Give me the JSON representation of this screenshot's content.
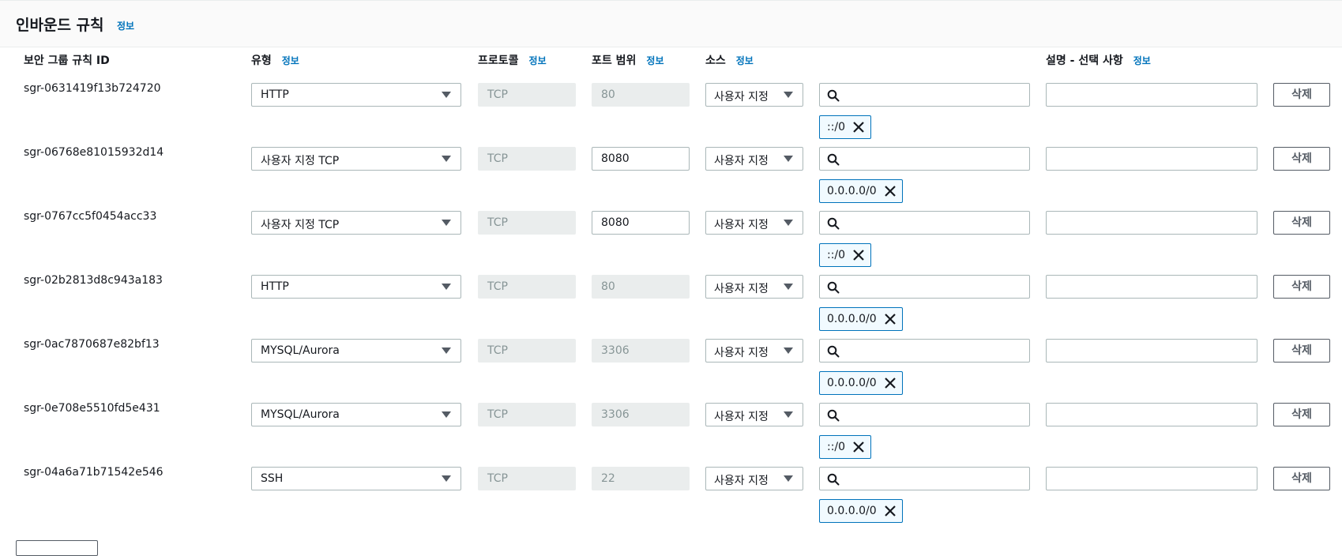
{
  "panel": {
    "title": "인바운드 규칙",
    "info": "정보"
  },
  "columns": {
    "rule_id": "보안 그룹 규칙 ID",
    "type": "유형",
    "protocol": "프로토콜",
    "port_range": "포트 범위",
    "source": "소스",
    "description": "설명 - 선택 사항",
    "info": "정보"
  },
  "rules": [
    {
      "id": "sgr-0631419f13b724720",
      "type": "HTTP",
      "protocol": "TCP",
      "port": "80",
      "port_editable": false,
      "source": "사용자 지정",
      "cidr": "::/0",
      "description": "",
      "delete_label": "삭제"
    },
    {
      "id": "sgr-06768e81015932d14",
      "type": "사용자 지정 TCP",
      "protocol": "TCP",
      "port": "8080",
      "port_editable": true,
      "source": "사용자 지정",
      "cidr": "0.0.0.0/0",
      "description": "",
      "delete_label": "삭제"
    },
    {
      "id": "sgr-0767cc5f0454acc33",
      "type": "사용자 지정 TCP",
      "protocol": "TCP",
      "port": "8080",
      "port_editable": true,
      "source": "사용자 지정",
      "cidr": "::/0",
      "description": "",
      "delete_label": "삭제"
    },
    {
      "id": "sgr-02b2813d8c943a183",
      "type": "HTTP",
      "protocol": "TCP",
      "port": "80",
      "port_editable": false,
      "source": "사용자 지정",
      "cidr": "0.0.0.0/0",
      "description": "",
      "delete_label": "삭제"
    },
    {
      "id": "sgr-0ac7870687e82bf13",
      "type": "MYSQL/Aurora",
      "protocol": "TCP",
      "port": "3306",
      "port_editable": false,
      "source": "사용자 지정",
      "cidr": "0.0.0.0/0",
      "description": "",
      "delete_label": "삭제"
    },
    {
      "id": "sgr-0e708e5510fd5e431",
      "type": "MYSQL/Aurora",
      "protocol": "TCP",
      "port": "3306",
      "port_editable": false,
      "source": "사용자 지정",
      "cidr": "::/0",
      "description": "",
      "delete_label": "삭제"
    },
    {
      "id": "sgr-04a6a71b71542e546",
      "type": "SSH",
      "protocol": "TCP",
      "port": "22",
      "port_editable": false,
      "source": "사용자 지정",
      "cidr": "0.0.0.0/0",
      "description": "",
      "delete_label": "삭제"
    }
  ],
  "colors": {
    "link": "#0073bb",
    "border": "#aab7b8",
    "disabled_bg": "#eaeded",
    "token_border": "#0073bb",
    "token_bg": "#f1faff"
  },
  "icons": {
    "search": "search-icon",
    "remove": "close-icon",
    "dropdown": "caret-down-icon"
  }
}
